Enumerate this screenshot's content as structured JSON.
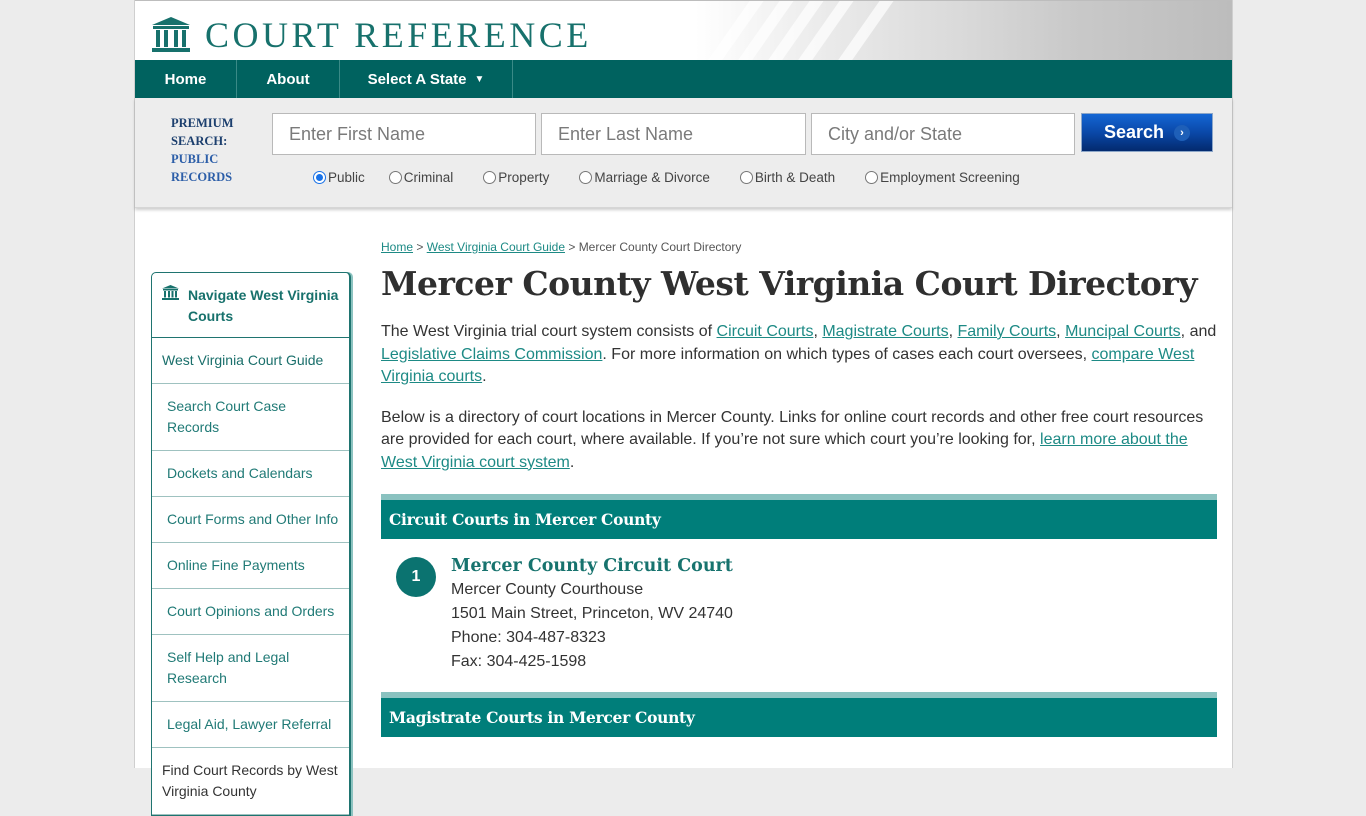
{
  "brand": {
    "name": "COURT REFERENCE",
    "icon": "courthouse-icon",
    "color": "#17716c"
  },
  "nav": {
    "items": [
      {
        "label": "Home"
      },
      {
        "label": "About"
      },
      {
        "label": "Select A State",
        "caret": "▼"
      }
    ]
  },
  "search": {
    "premium_line1": "PREMIUM",
    "premium_line2": "SEARCH:",
    "premium_line3": "PUBLIC",
    "premium_line4": "RECORDS",
    "first_name_placeholder": "Enter First Name",
    "last_name_placeholder": "Enter Last Name",
    "location_placeholder": "City and/or State",
    "button_label": "Search",
    "button_icon": "›",
    "radio_options": [
      {
        "label": "Public",
        "checked": true
      },
      {
        "label": "Criminal",
        "checked": false
      },
      {
        "label": "Property",
        "checked": false
      },
      {
        "label": "Marriage & Divorce",
        "checked": false
      },
      {
        "label": "Birth & Death",
        "checked": false
      },
      {
        "label": "Employment Screening",
        "checked": false
      }
    ]
  },
  "sidebar": {
    "title": "Navigate West Virginia Courts",
    "items": [
      {
        "label": "West Virginia Court Guide"
      },
      {
        "label": "Search Court Case Records"
      },
      {
        "label": "Dockets and Calendars"
      },
      {
        "label": "Court Forms and Other Info"
      },
      {
        "label": "Online Fine Payments"
      },
      {
        "label": "Court Opinions and Orders"
      },
      {
        "label": "Self Help and Legal Research"
      },
      {
        "label": "Legal Aid, Lawyer Referral"
      },
      {
        "label": "Find Court Records by West Virginia County"
      }
    ]
  },
  "breadcrumb": {
    "home": "Home",
    "sep": " > ",
    "guide": "West Virginia Court Guide",
    "current": "Mercer County Court Directory"
  },
  "page_title": "Mercer County West Virginia Court Directory",
  "intro": {
    "t1": "The West Virginia trial court system consists of ",
    "l1": "Circuit Courts",
    "c1": ", ",
    "l2": "Magistrate Courts",
    "c2": ", ",
    "l3": "Family Courts",
    "c3": ", ",
    "l4": "Muncipal Courts",
    "c4": ", and ",
    "l5": "Legislative Claims Commission",
    "t2": ". For more information on which types of cases each court oversees, ",
    "l6": "compare West Virginia courts",
    "t3": "."
  },
  "directory_intro": {
    "t1": "Below is a directory of court locations in Mercer County. Links for online court records and other free court resources are provided for each court, where available. If you’re not sure which court you’re looking for, ",
    "link": "learn more about the West Virginia court system",
    "t2": "."
  },
  "sections": [
    {
      "title": "Circuit Courts in Mercer County",
      "courts": [
        {
          "number": "1",
          "name": "Mercer County Circuit Court",
          "building": "Mercer County Courthouse",
          "address": "1501 Main Street, Princeton, WV 24740",
          "phone": "Phone: 304-487-8323",
          "fax": "Fax: 304-425-1598"
        }
      ]
    },
    {
      "title": "Magistrate Courts in Mercer County"
    }
  ]
}
